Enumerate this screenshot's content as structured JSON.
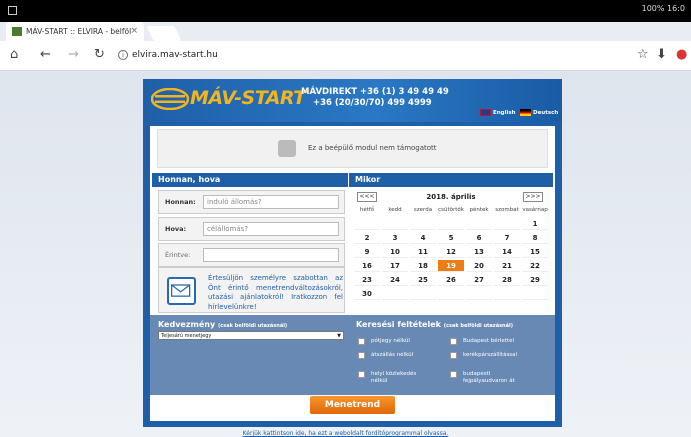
{
  "browser": {
    "status_right": "100% 16:0",
    "tab_title": "MÁV-START :: ELVIRA - belföl",
    "tab_close": "×",
    "url": "elvira.mav-start.hu",
    "info": "i"
  },
  "header": {
    "logo_text": "MÁV-START",
    "direkt_line1": "MÁVDIREKT +36 (1) 3 49 49 49",
    "direkt_line2": "+36 (20/30/70) 499 4999",
    "lang_en": "English",
    "lang_de": "Deutsch"
  },
  "plugin": {
    "message": "Ez a beépülő modul nem támogatott"
  },
  "from_to": {
    "section_title": "Honnan, hova",
    "from_label": "Honnan:",
    "from_placeholder": "induló állomás?",
    "to_label": "Hova:",
    "to_placeholder": "célállomás?",
    "via_label": "Érintve:",
    "via_value": ""
  },
  "newsletter": {
    "text": "Értesüljön személyre szabottan az Önt érintő menetrendváltozásokról, utazási ajánlatokról! Iratkozzon fel hírlevelünkre!"
  },
  "calendar": {
    "section_title": "Mikor",
    "prev": "<<<",
    "next": ">>>",
    "month_title": "2018. április",
    "weekdays": [
      "hétfő",
      "kedd",
      "szerda",
      "csütörtök",
      "péntek",
      "szombat",
      "vasárnap"
    ],
    "weeks": [
      [
        "",
        "",
        "",
        "",
        "",
        "",
        "1"
      ],
      [
        "2",
        "3",
        "4",
        "5",
        "6",
        "7",
        "8"
      ],
      [
        "9",
        "10",
        "11",
        "12",
        "13",
        "14",
        "15"
      ],
      [
        "16",
        "17",
        "18",
        "19",
        "20",
        "21",
        "22"
      ],
      [
        "23",
        "24",
        "25",
        "26",
        "27",
        "28",
        "29"
      ],
      [
        "30",
        "",
        "",
        "",
        "",
        "",
        ""
      ]
    ],
    "selected_day": "19"
  },
  "discount": {
    "title": "Kedvezmény",
    "subtitle": "(csak belföldi utazásnál)",
    "selected": "Teljesárú menetjegy"
  },
  "search": {
    "title": "Keresési feltételek",
    "subtitle": "(csak belföldi utazásnál)",
    "options": [
      "pótjegy nélkül",
      "Budapest bérlettel",
      "átszállás nélkül",
      "kerékpárszállítással",
      "helyi közlekedés nélkül",
      "budapesti fejpályaudvaron át"
    ]
  },
  "actions": {
    "submit": "Menetrend",
    "footer_link": "Kérjük kattintson ide, ha ezt a weboldalt fordítóprogrammal olvassa."
  },
  "colors": {
    "brand_blue": "#1f5fa8",
    "accent_orange": "#f07d14",
    "logo_yellow": "#f2b51e"
  }
}
